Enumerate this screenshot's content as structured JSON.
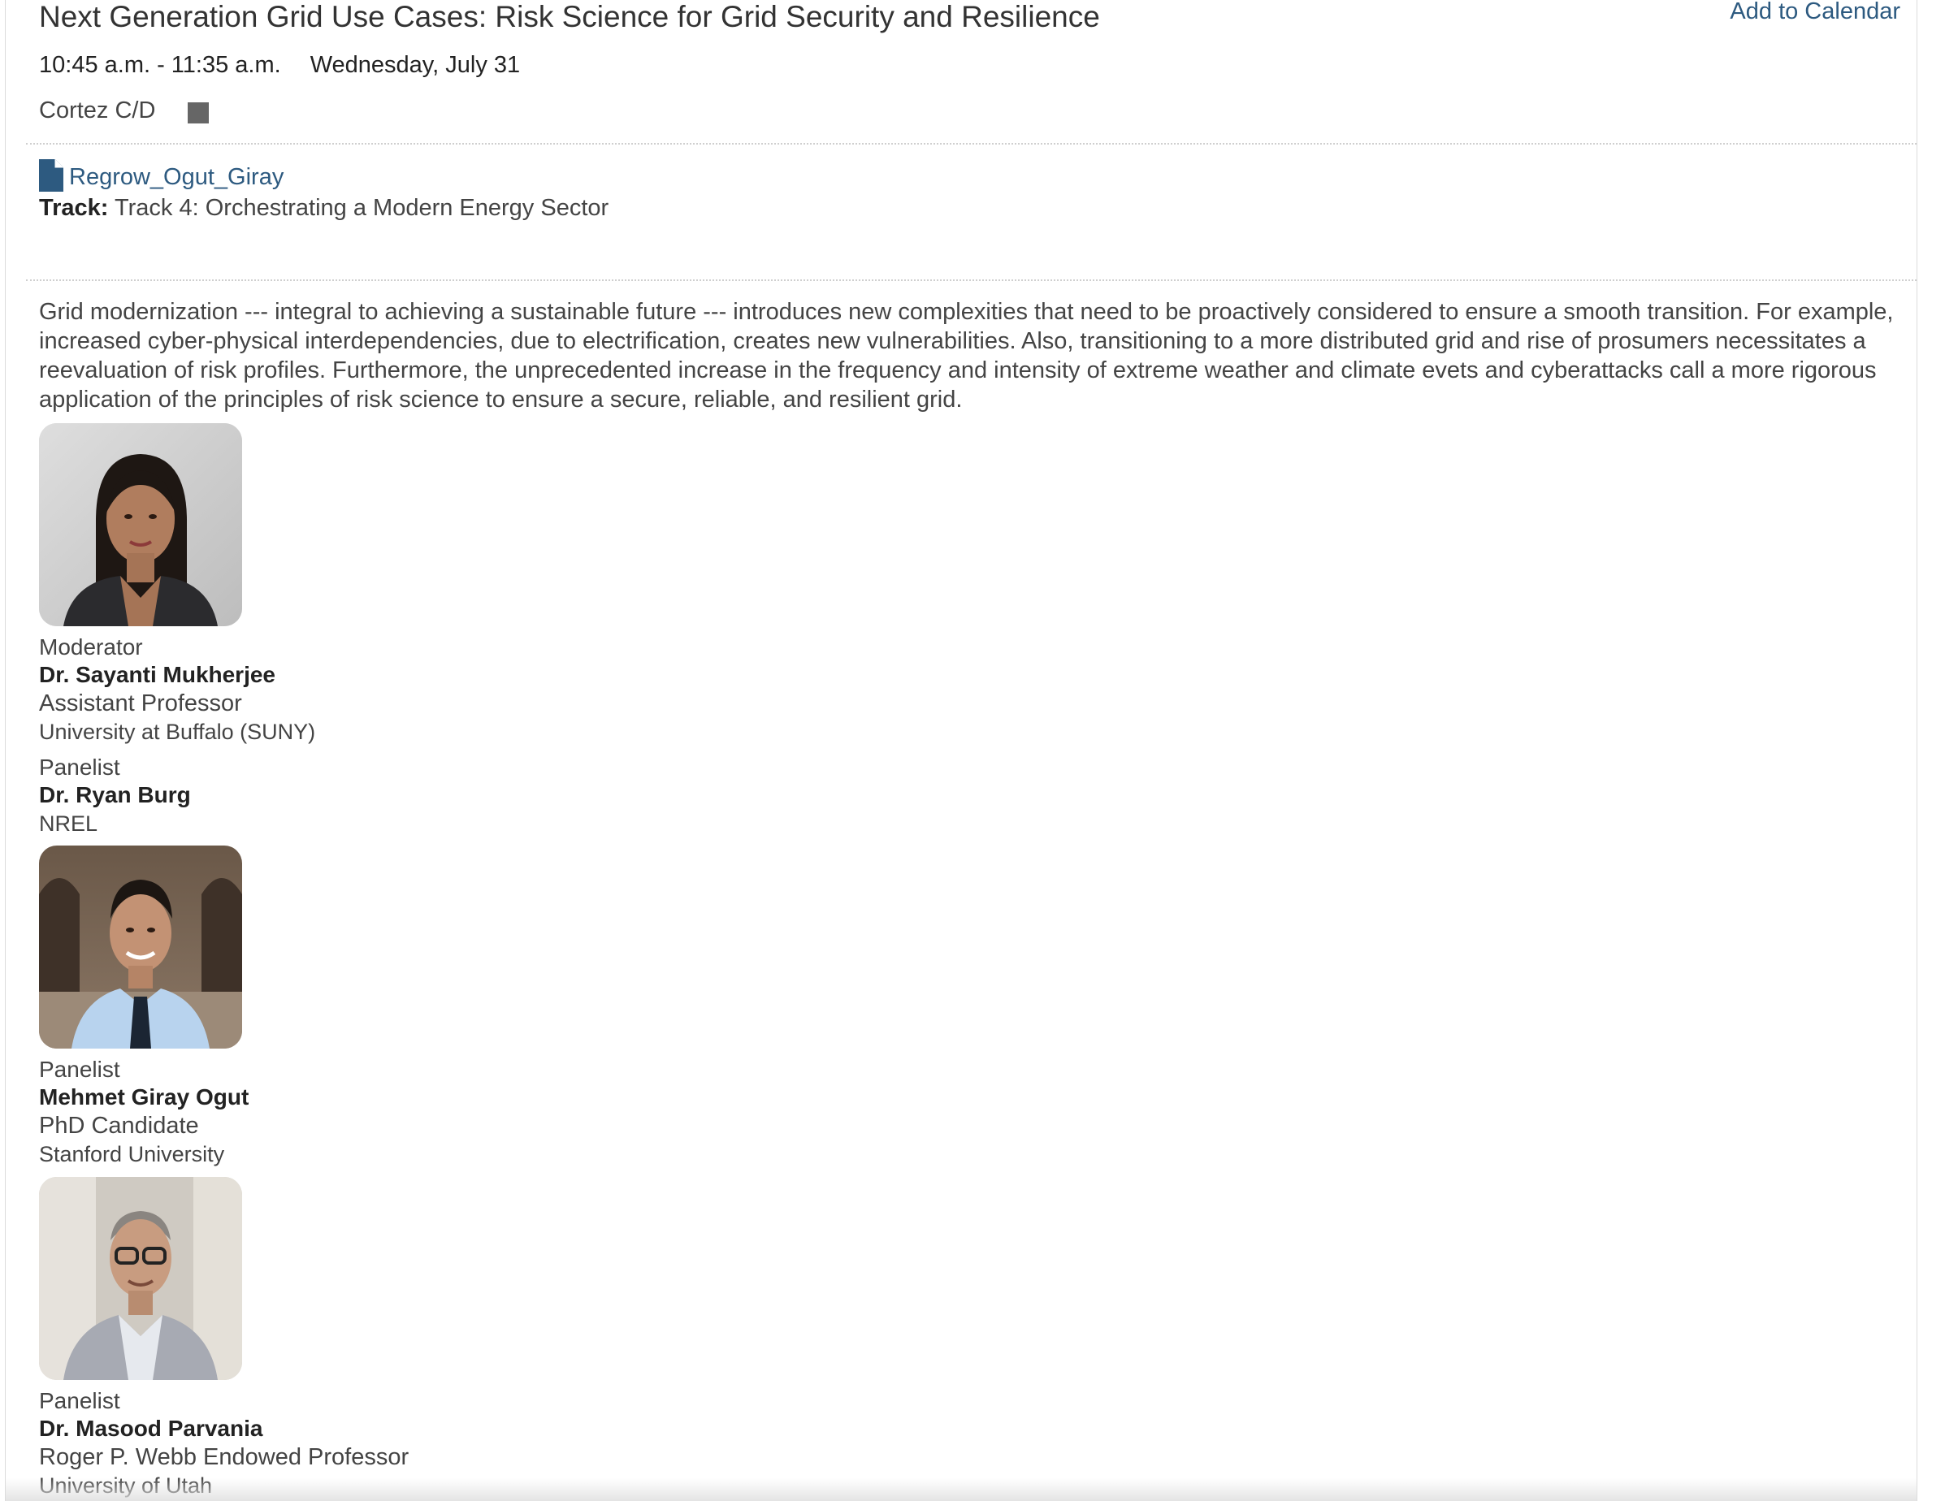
{
  "session": {
    "title": "Next Generation Grid Use Cases: Risk Science for Grid Security and Resilience",
    "add_to_calendar": "Add to Calendar",
    "time": "10:45 a.m. - 11:35 a.m.",
    "date": "Wednesday, July 31",
    "room": "Cortez C/D",
    "room_color": "#666666",
    "document": {
      "label": "Regrow_Ogut_Giray",
      "icon": "file-icon"
    },
    "track_label": "Track:",
    "track_value": "Track 4: Orchestrating a Modern Energy Sector",
    "description": "Grid modernization --- integral to achieving a sustainable future --- introduces new complexities that need to be proactively considered to ensure a smooth transition. For example, increased cyber-physical interdependencies, due to electrification, creates new vulnerabilities. Also, transitioning to a more distributed grid and rise of prosumers necessitates a reevaluation of risk profiles. Furthermore, the unprecedented increase in the frequency and intensity of extreme weather and climate evets and cyberattacks call a more rigorous application of the principles of risk science to ensure a secure, reliable, and resilient grid."
  },
  "speakers": [
    {
      "role": "Moderator",
      "name": "Dr. Sayanti Mukherjee",
      "title": "Assistant Professor",
      "org": "University at Buffalo (SUNY)"
    },
    {
      "role": "Panelist",
      "name": "Dr. Ryan Burg",
      "org": "NREL"
    },
    {
      "role": "Panelist",
      "name": "Mehmet Giray Ogut",
      "title": "PhD Candidate",
      "org": "Stanford University"
    },
    {
      "role": "Panelist",
      "name": "Dr. Masood Parvania",
      "title": "Roger P. Webb Endowed Professor",
      "org": "University of Utah"
    }
  ],
  "colors": {
    "link": "#2d5a80",
    "text": "#333333",
    "divider": "#cfcfcf"
  }
}
